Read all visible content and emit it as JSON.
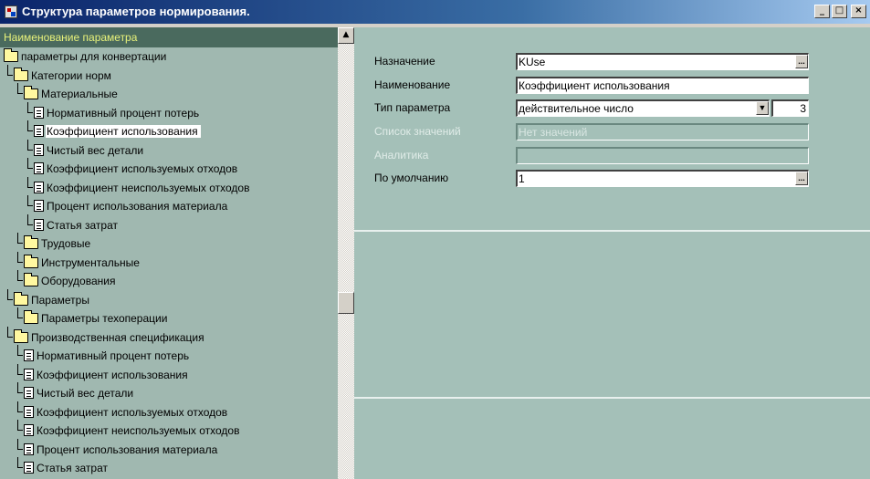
{
  "window": {
    "title": "Структура параметров нормирования."
  },
  "tree": {
    "header": "Наименование параметра",
    "items": [
      {
        "label": "параметры для конвертации",
        "level": 0,
        "type": "folder-open"
      },
      {
        "label": "Категории норм",
        "level": 1,
        "type": "folder-open"
      },
      {
        "label": "Материальные",
        "level": 2,
        "type": "folder-open"
      },
      {
        "label": "Нормативный процент потерь",
        "level": 3,
        "type": "doc"
      },
      {
        "label": "Коэффициент использования",
        "level": 3,
        "type": "doc",
        "selected": true
      },
      {
        "label": "Чистый вес детали",
        "level": 3,
        "type": "doc"
      },
      {
        "label": "Коэффициент используемых отходов",
        "level": 3,
        "type": "doc"
      },
      {
        "label": "Коэффициент неиспользуемых отходов",
        "level": 3,
        "type": "doc"
      },
      {
        "label": "Процент использования материала",
        "level": 3,
        "type": "doc"
      },
      {
        "label": "Статья затрат",
        "level": 3,
        "type": "doc"
      },
      {
        "label": "Трудовые",
        "level": 2,
        "type": "folder"
      },
      {
        "label": "Инструментальные",
        "level": 2,
        "type": "folder"
      },
      {
        "label": "Оборудования",
        "level": 2,
        "type": "folder"
      },
      {
        "label": "Параметры",
        "level": 1,
        "type": "folder-open"
      },
      {
        "label": "Параметры техоперации",
        "level": 2,
        "type": "folder"
      },
      {
        "label": "Производственная спецификация",
        "level": 1,
        "type": "folder-open"
      },
      {
        "label": "Нормативный процент потерь",
        "level": 2,
        "type": "doc"
      },
      {
        "label": "Коэффициент использования",
        "level": 2,
        "type": "doc"
      },
      {
        "label": "Чистый вес детали",
        "level": 2,
        "type": "doc"
      },
      {
        "label": "Коэффициент используемых отходов",
        "level": 2,
        "type": "doc"
      },
      {
        "label": "Коэффициент неиспользуемых отходов",
        "level": 2,
        "type": "doc"
      },
      {
        "label": "Процент использования материала",
        "level": 2,
        "type": "doc"
      },
      {
        "label": "Статья затрат",
        "level": 2,
        "type": "doc"
      }
    ]
  },
  "form": {
    "purpose_label": "Назначение",
    "purpose_value": "KUse",
    "name_label": "Наименование",
    "name_value": "Коэффициент использования",
    "type_label": "Тип параметра",
    "type_value": "действительное число",
    "type_precision": "3",
    "values_list_label": "Список значений",
    "values_list_value": "Нет значений",
    "analytics_label": "Аналитика",
    "analytics_value": "",
    "default_label": "По умолчанию",
    "default_value": "1",
    "browse_glyph": "...",
    "dropdown_glyph": "▼"
  },
  "colors": {
    "tree_bg": "#a0b8b0",
    "header_bg": "#4a6a5e",
    "header_text": "#e8f27a",
    "panel_bg": "#a4c0b8"
  }
}
